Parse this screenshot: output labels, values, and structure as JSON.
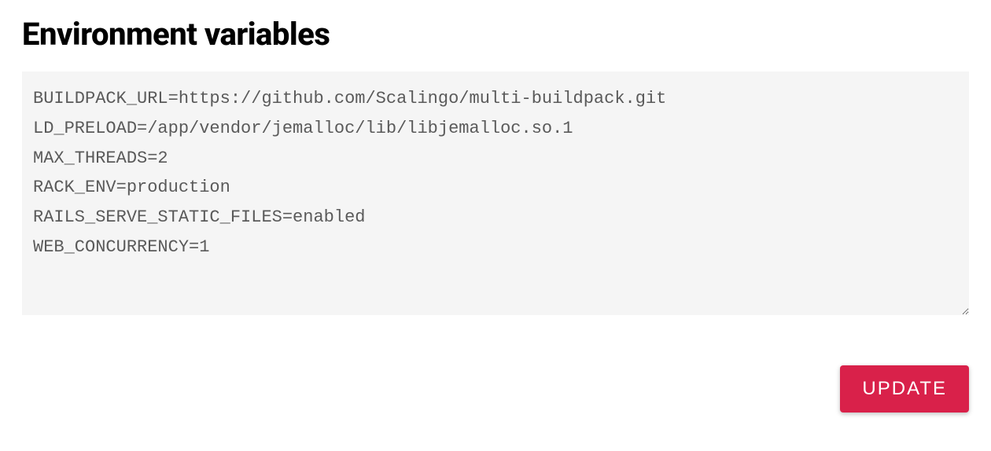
{
  "header": {
    "title": "Environment variables"
  },
  "env": {
    "value": "BUILDPACK_URL=https://github.com/Scalingo/multi-buildpack.git\nLD_PRELOAD=/app/vendor/jemalloc/lib/libjemalloc.so.1\nMAX_THREADS=2\nRACK_ENV=production\nRAILS_SERVE_STATIC_FILES=enabled\nWEB_CONCURRENCY=1"
  },
  "actions": {
    "update_label": "UPDATE"
  }
}
